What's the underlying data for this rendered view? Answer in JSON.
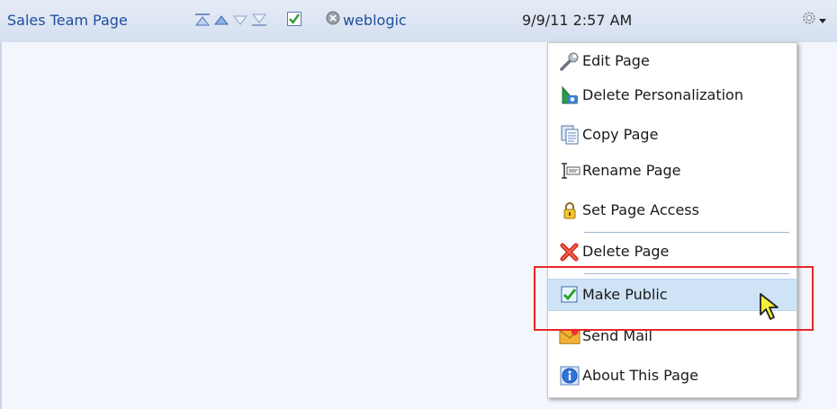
{
  "header": {
    "page_name": "Sales Team Page",
    "move_controls": [
      "move-top-icon",
      "move-up-icon",
      "move-down-icon",
      "move-bottom-icon"
    ],
    "user": "weblogic",
    "timestamp": "9/9/11 2:57 AM"
  },
  "menu": {
    "items": [
      {
        "label": "Edit Page",
        "icon": "wrench-icon"
      },
      {
        "label": "Delete Personalization",
        "icon": "delete-personalization-icon"
      },
      {
        "label": "Copy Page",
        "icon": "copy-pages-icon"
      },
      {
        "label": "Rename Page",
        "icon": "rename-textfield-icon"
      },
      {
        "label": "Set Page Access",
        "icon": "lock-icon"
      },
      {
        "label": "Delete Page",
        "icon": "red-x-icon"
      },
      {
        "label": "Make Public",
        "icon": "checkbox-checked-icon",
        "highlighted": true
      },
      {
        "label": "Send Mail",
        "icon": "envelope-icon"
      },
      {
        "label": "About This Page",
        "icon": "info-icon"
      }
    ]
  },
  "colors": {
    "accent_link": "#1f4f9c",
    "highlight": "#cfe3f7",
    "annotation_box": "#e8262a"
  }
}
